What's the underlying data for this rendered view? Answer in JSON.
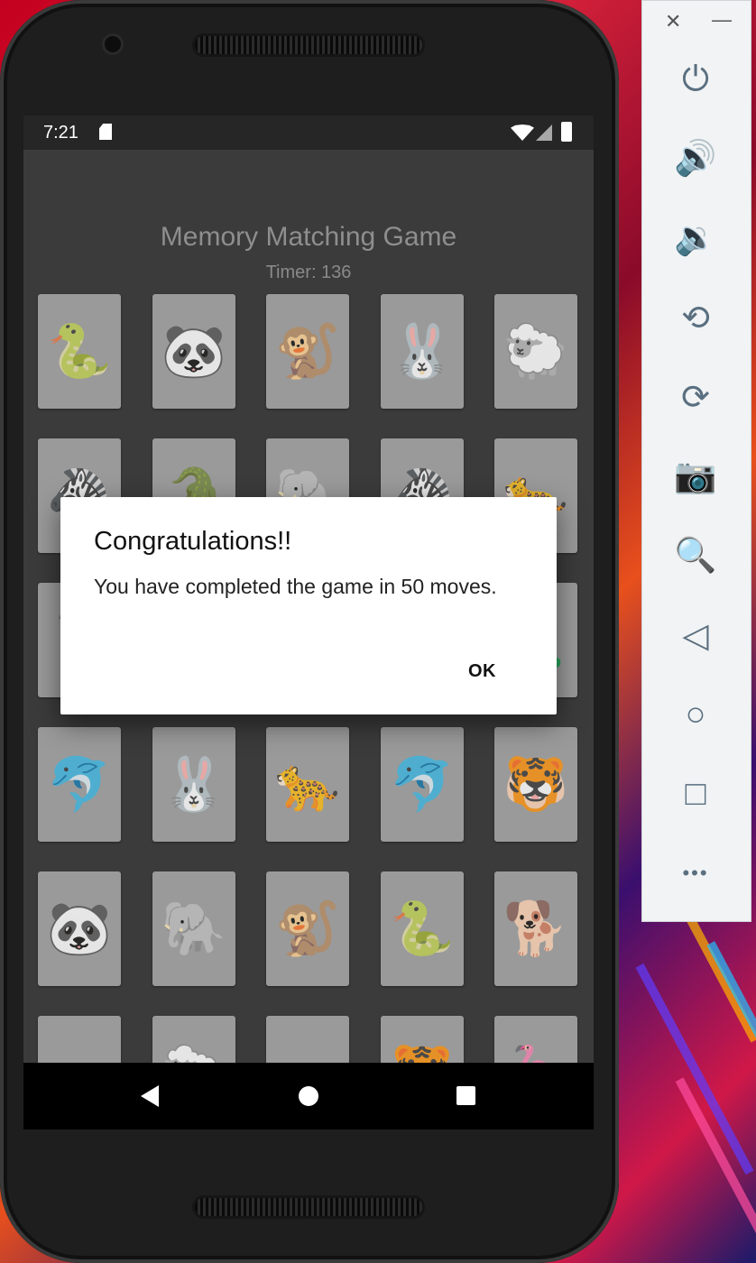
{
  "status_bar": {
    "time": "7:21"
  },
  "app": {
    "title": "Memory Matching Game",
    "timer_text": "Timer: 136"
  },
  "cards": [
    [
      "🐍",
      "🐼",
      "🐒",
      "🐰",
      "🐑"
    ],
    [
      "🦓",
      "🐊",
      "🐘",
      "🦓",
      "🐆"
    ],
    [
      "🦩",
      "",
      "",
      "",
      "🦎"
    ],
    [
      "🐬",
      "🐰",
      "🐆",
      "🐬",
      "🐯"
    ],
    [
      "🐼",
      "🐘",
      "🐒",
      "🐍",
      "🐕"
    ],
    [
      "",
      "🐑",
      "",
      "🐯",
      "🦩"
    ]
  ],
  "dialog": {
    "title": "Congratulations!!",
    "message": "You have completed the game in 50 moves.",
    "ok_label": "OK"
  },
  "emulator_toolbar": {
    "close": "✕",
    "minimize": "—",
    "buttons": [
      "power-icon",
      "volume-up-icon",
      "volume-down-icon",
      "rotate-left-icon",
      "rotate-right-icon",
      "camera-icon",
      "zoom-icon",
      "back-icon",
      "home-icon",
      "overview-icon",
      "more-icon"
    ],
    "glyphs": [
      "⏻",
      "🔊",
      "🔉",
      "⟲",
      "⟳",
      "📷",
      "🔍",
      "◁",
      "○",
      "□",
      "•••"
    ]
  }
}
